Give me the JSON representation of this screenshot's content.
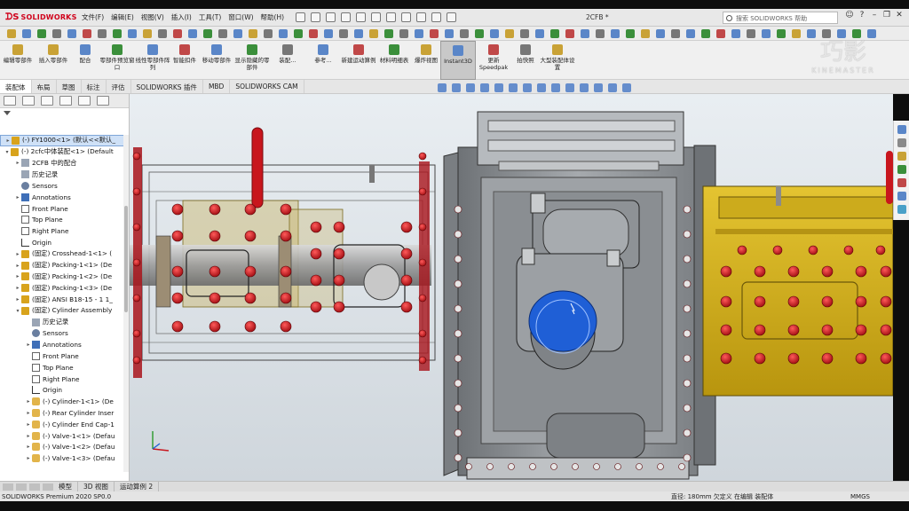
{
  "app": {
    "brand": "SOLIDWORKS",
    "document_title": "2CFB *"
  },
  "menu": [
    "文件(F)",
    "编辑(E)",
    "视图(V)",
    "插入(I)",
    "工具(T)",
    "窗口(W)",
    "帮助(H)"
  ],
  "search": {
    "placeholder": "搜索 SOLIDWORKS 帮助"
  },
  "command_manager": [
    {
      "label": "编辑零部件"
    },
    {
      "label": "插入零部件"
    },
    {
      "label": "配合"
    },
    {
      "label": "零部件预览窗口"
    },
    {
      "label": "线性零部件阵列"
    },
    {
      "label": "智能扣件"
    },
    {
      "label": "移动零部件"
    },
    {
      "label": "显示隐藏的零部件"
    },
    {
      "label": "装配..."
    },
    {
      "label": "参考..."
    },
    {
      "label": "新建运动算例"
    },
    {
      "label": "材料明细表"
    },
    {
      "label": "爆炸视图"
    },
    {
      "label": "Instant3D"
    },
    {
      "label": "更新 Speedpak"
    },
    {
      "label": "拍快照"
    },
    {
      "label": "大型装配体设置"
    }
  ],
  "watermark": {
    "big": "巧影",
    "small": "KINEMASTER"
  },
  "tabs": [
    "装配体",
    "布局",
    "草图",
    "标注",
    "评估",
    "SOLIDWORKS 插件",
    "MBD",
    "SOLIDWORKS CAM"
  ],
  "active_tab": "装配体",
  "feature_tree": [
    {
      "label": "(-) FY1000<1> (默认<<默认_",
      "icon": "asm",
      "indent": 0,
      "toggle": "▸",
      "selected": true
    },
    {
      "label": "(-) 2cfc中体装配<1> (Default",
      "icon": "asm",
      "indent": 0,
      "toggle": "▾"
    },
    {
      "label": "2CFB 中的配合",
      "icon": "folder",
      "indent": 1,
      "toggle": "▸"
    },
    {
      "label": "历史记录",
      "icon": "folder",
      "indent": 1,
      "toggle": ""
    },
    {
      "label": "Sensors",
      "icon": "sensor",
      "indent": 1,
      "toggle": ""
    },
    {
      "label": "Annotations",
      "icon": "annot",
      "indent": 1,
      "toggle": "▸"
    },
    {
      "label": "Front Plane",
      "icon": "plane",
      "indent": 1,
      "toggle": ""
    },
    {
      "label": "Top Plane",
      "icon": "plane",
      "indent": 1,
      "toggle": ""
    },
    {
      "label": "Right Plane",
      "icon": "plane",
      "indent": 1,
      "toggle": ""
    },
    {
      "label": "Origin",
      "icon": "origin",
      "indent": 1,
      "toggle": ""
    },
    {
      "label": "(固定) Crosshead-1<1> (",
      "icon": "asm",
      "indent": 1,
      "toggle": "▸"
    },
    {
      "label": "(固定) Packing-1<1> (De",
      "icon": "asm",
      "indent": 1,
      "toggle": "▸"
    },
    {
      "label": "(固定) Packing-1<2> (De",
      "icon": "asm",
      "indent": 1,
      "toggle": "▸"
    },
    {
      "label": "(固定) Packing-1<3> (De",
      "icon": "asm",
      "indent": 1,
      "toggle": "▸"
    },
    {
      "label": "(固定) ANSI B18-15 - 1 1_",
      "icon": "asm",
      "indent": 1,
      "toggle": "▸"
    },
    {
      "label": "(固定) Cylinder Assembly",
      "icon": "asm",
      "indent": 1,
      "toggle": "▾"
    },
    {
      "label": "历史记录",
      "icon": "folder",
      "indent": 2,
      "toggle": ""
    },
    {
      "label": "Sensors",
      "icon": "sensor",
      "indent": 2,
      "toggle": ""
    },
    {
      "label": "Annotations",
      "icon": "annot",
      "indent": 2,
      "toggle": "▸"
    },
    {
      "label": "Front Plane",
      "icon": "plane",
      "indent": 2,
      "toggle": ""
    },
    {
      "label": "Top Plane",
      "icon": "plane",
      "indent": 2,
      "toggle": ""
    },
    {
      "label": "Right Plane",
      "icon": "plane",
      "indent": 2,
      "toggle": ""
    },
    {
      "label": "Origin",
      "icon": "origin",
      "indent": 2,
      "toggle": ""
    },
    {
      "label": "(-) Cylinder-1<1> (De",
      "icon": "part",
      "indent": 2,
      "toggle": "▸"
    },
    {
      "label": "(-) Rear Cylinder Inser",
      "icon": "part",
      "indent": 2,
      "toggle": "▸"
    },
    {
      "label": "(-) Cylinder End Cap-1",
      "icon": "part",
      "indent": 2,
      "toggle": "▸"
    },
    {
      "label": "(-) Valve-1<1> (Defau",
      "icon": "part",
      "indent": 2,
      "toggle": "▸"
    },
    {
      "label": "(-) Valve-1<2> (Defau",
      "icon": "part",
      "indent": 2,
      "toggle": "▸"
    },
    {
      "label": "(-) Valve-1<3> (Defau",
      "icon": "part",
      "indent": 2,
      "toggle": "▸"
    }
  ],
  "bottom_tabs": [
    "模型",
    "3D 视图",
    "运动算例 2"
  ],
  "status": {
    "version": "SOLIDWORKS Premium 2020 SP0.0",
    "info": "直径: 180mm  欠定义   在编辑 装配体",
    "units": "MMGS"
  },
  "colors": {
    "housing_gray": "#8d9094",
    "yellow": "#d9b51a",
    "bolt_red": "#c8161d",
    "highlight_blue": "#1f5fd6",
    "brand_red": "#d0021b"
  }
}
